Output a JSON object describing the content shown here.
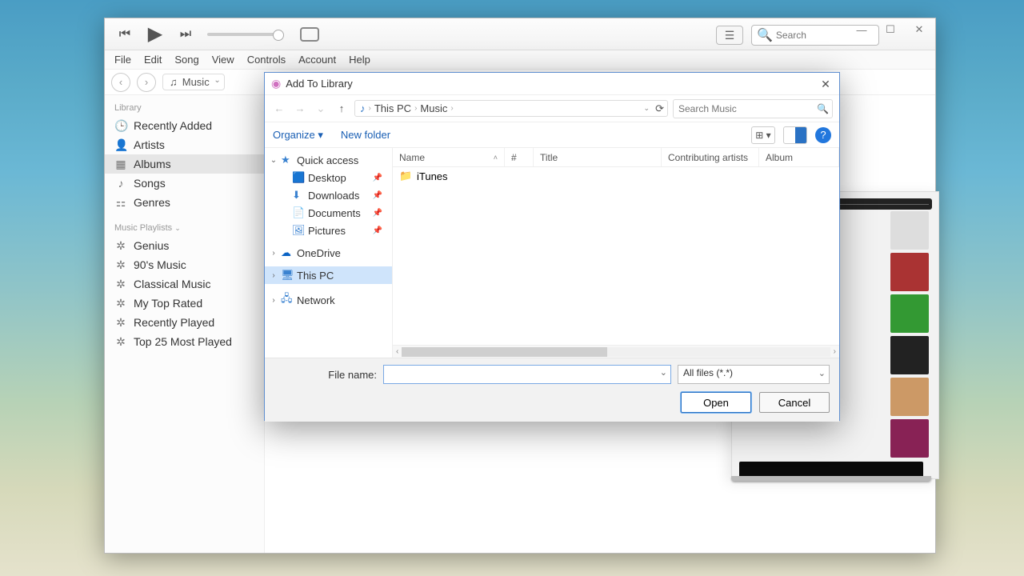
{
  "itunes": {
    "menus": [
      "File",
      "Edit",
      "Song",
      "View",
      "Controls",
      "Account",
      "Help"
    ],
    "search_placeholder": "Search",
    "dropdown_label": "Music",
    "library_header": "Library",
    "library_items": [
      "Recently Added",
      "Artists",
      "Albums",
      "Songs",
      "Genres"
    ],
    "library_selected": 2,
    "playlists_header": "Music Playlists",
    "playlist_items": [
      "Genius",
      "90's Music",
      "Classical Music",
      "My Top Rated",
      "Recently Played",
      "Top 25 Most Played"
    ]
  },
  "dialog": {
    "title": "Add To Library",
    "breadcrumb": [
      "This PC",
      "Music"
    ],
    "search_placeholder": "Search Music",
    "organize_label": "Organize",
    "new_folder_label": "New folder",
    "columns": [
      "Name",
      "#",
      "Title",
      "Contributing artists",
      "Album"
    ],
    "tree": {
      "quick_access": "Quick access",
      "qa_items": [
        "Desktop",
        "Downloads",
        "Documents",
        "Pictures"
      ],
      "onedrive": "OneDrive",
      "this_pc": "This PC",
      "network": "Network"
    },
    "files": [
      {
        "name": "iTunes",
        "type": "folder"
      }
    ],
    "file_name_label": "File name:",
    "filter_label": "All files (*.*)",
    "open_label": "Open",
    "cancel_label": "Cancel"
  }
}
